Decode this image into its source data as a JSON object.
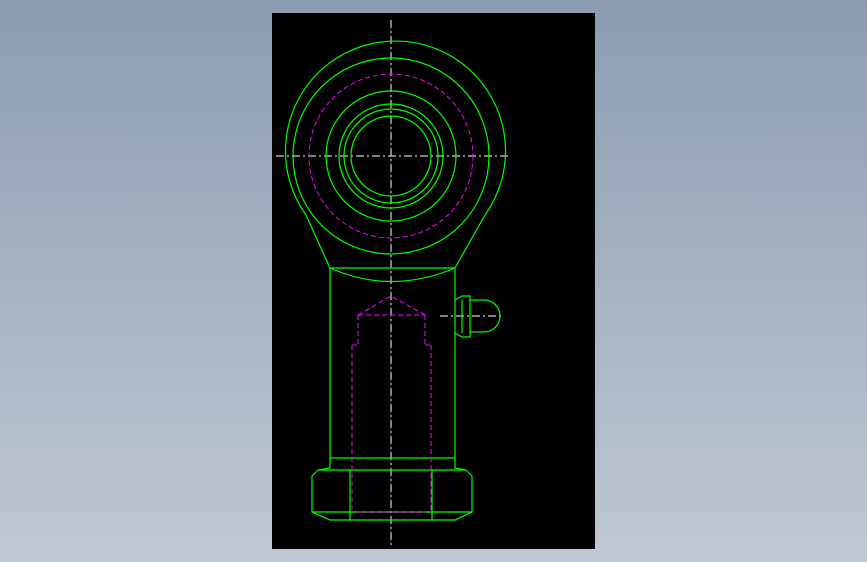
{
  "window": {
    "background_top": "#8c9cb0",
    "background_bottom": "#c0c7d2"
  },
  "viewport": {
    "background": "#000000"
  },
  "drawing": {
    "subject": "rod-end-bearing",
    "colors": {
      "visible_lines": "#00ff00",
      "hidden_lines": "#ff00ff",
      "center_lines": "#ffffff"
    },
    "line_styles": {
      "hidden": "dashed",
      "center": "dash-dot"
    }
  }
}
